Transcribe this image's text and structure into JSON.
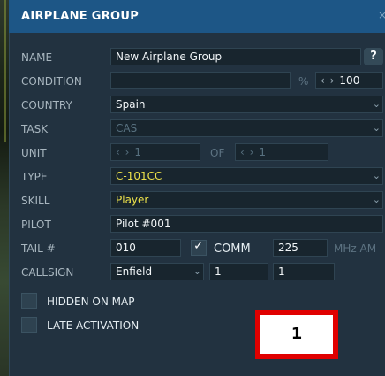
{
  "window": {
    "title": "AIRPLANE GROUP",
    "close_glyph": "×"
  },
  "labels": {
    "name": "NAME",
    "condition": "CONDITION",
    "country": "COUNTRY",
    "task": "TASK",
    "unit": "UNIT",
    "type": "TYPE",
    "skill": "SKILL",
    "pilot": "PILOT",
    "tail": "TAIL #",
    "callsign": "CALLSIGN"
  },
  "fields": {
    "name_value": "New Airplane Group",
    "help_label": "?",
    "condition_percent_unit": "%",
    "condition_value": "100",
    "country_value": "Spain",
    "task_value": "CAS",
    "unit_value": "1",
    "unit_of_label": "OF",
    "unit_total": "1",
    "type_value": "C-101CC",
    "skill_value": "Player",
    "pilot_value": "Pilot #001",
    "tail_value": "010",
    "comm_label": "COMM",
    "comm_frequency": "225",
    "frequency_unit": "MHz AM",
    "callsign_value": "Enfield",
    "callsign_number_1": "1",
    "callsign_number_2": "1"
  },
  "checkboxes": {
    "comm_checked": true,
    "hidden_on_map_label": "HIDDEN ON MAP",
    "hidden_on_map_checked": false,
    "late_activation_label": "LATE ACTIVATION",
    "late_activation_checked": false
  },
  "annotation": {
    "label": "1",
    "border_color": "#e00000"
  },
  "colors": {
    "title_bar": "#1d5686",
    "panel": "#223240",
    "highlight_text": "#ece14a"
  },
  "icons": {
    "spinner": "spinner-arrows-icon",
    "dropdown": "chevron-down-icon",
    "check": "checkmark-icon",
    "close": "close-icon",
    "help": "help-icon"
  }
}
